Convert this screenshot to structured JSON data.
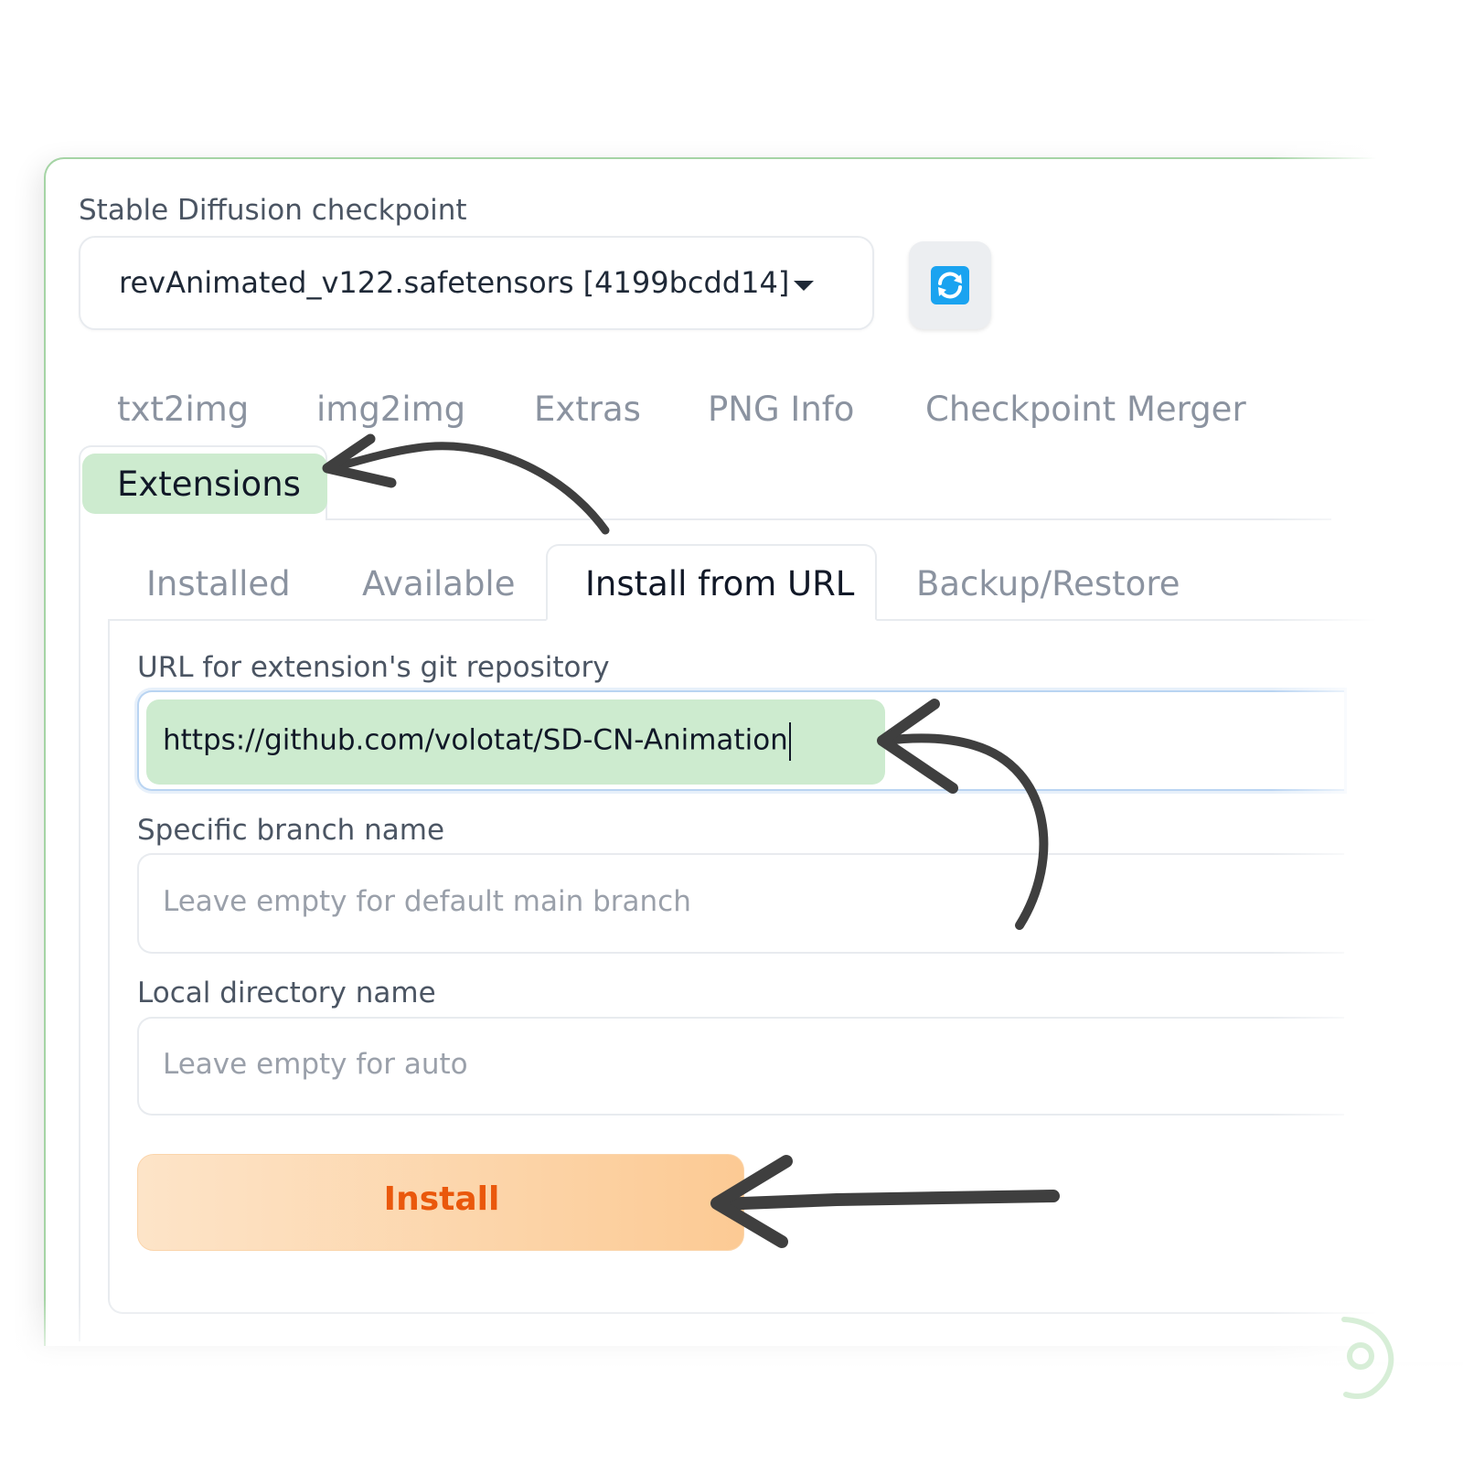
{
  "checkpoint": {
    "label": "Stable Diffusion checkpoint",
    "value": "revAnimated_v122.safetensors [4199bcdd14]"
  },
  "top_tabs": [
    "txt2img",
    "img2img",
    "Extras",
    "PNG Info",
    "Checkpoint Merger",
    "Extensions"
  ],
  "active_top_tab": "Extensions",
  "sub_tabs": [
    "Installed",
    "Available",
    "Install from URL",
    "Backup/Restore"
  ],
  "active_sub_tab": "Install from URL",
  "form": {
    "url_label": "URL for extension's git repository",
    "url_value": "https://github.com/volotat/SD-CN-Animation",
    "branch_label": "Specific branch name",
    "branch_placeholder": "Leave empty for default main branch",
    "dir_label": "Local directory name",
    "dir_placeholder": "Leave empty for auto",
    "install_label": "Install"
  },
  "icons": {
    "refresh": "refresh-icon",
    "dropdown": "chevron-down-icon",
    "annotation": "arrow-icon",
    "logo": "logo-icon"
  },
  "colors": {
    "highlight": "#cdebcf",
    "card_border": "#a5d4a5",
    "install_text": "#ea580c",
    "install_bg_start": "#fde4c8",
    "install_bg_end": "#fcca94",
    "refresh_icon": "#1aa3f0",
    "arrow": "#3f3f3f"
  }
}
